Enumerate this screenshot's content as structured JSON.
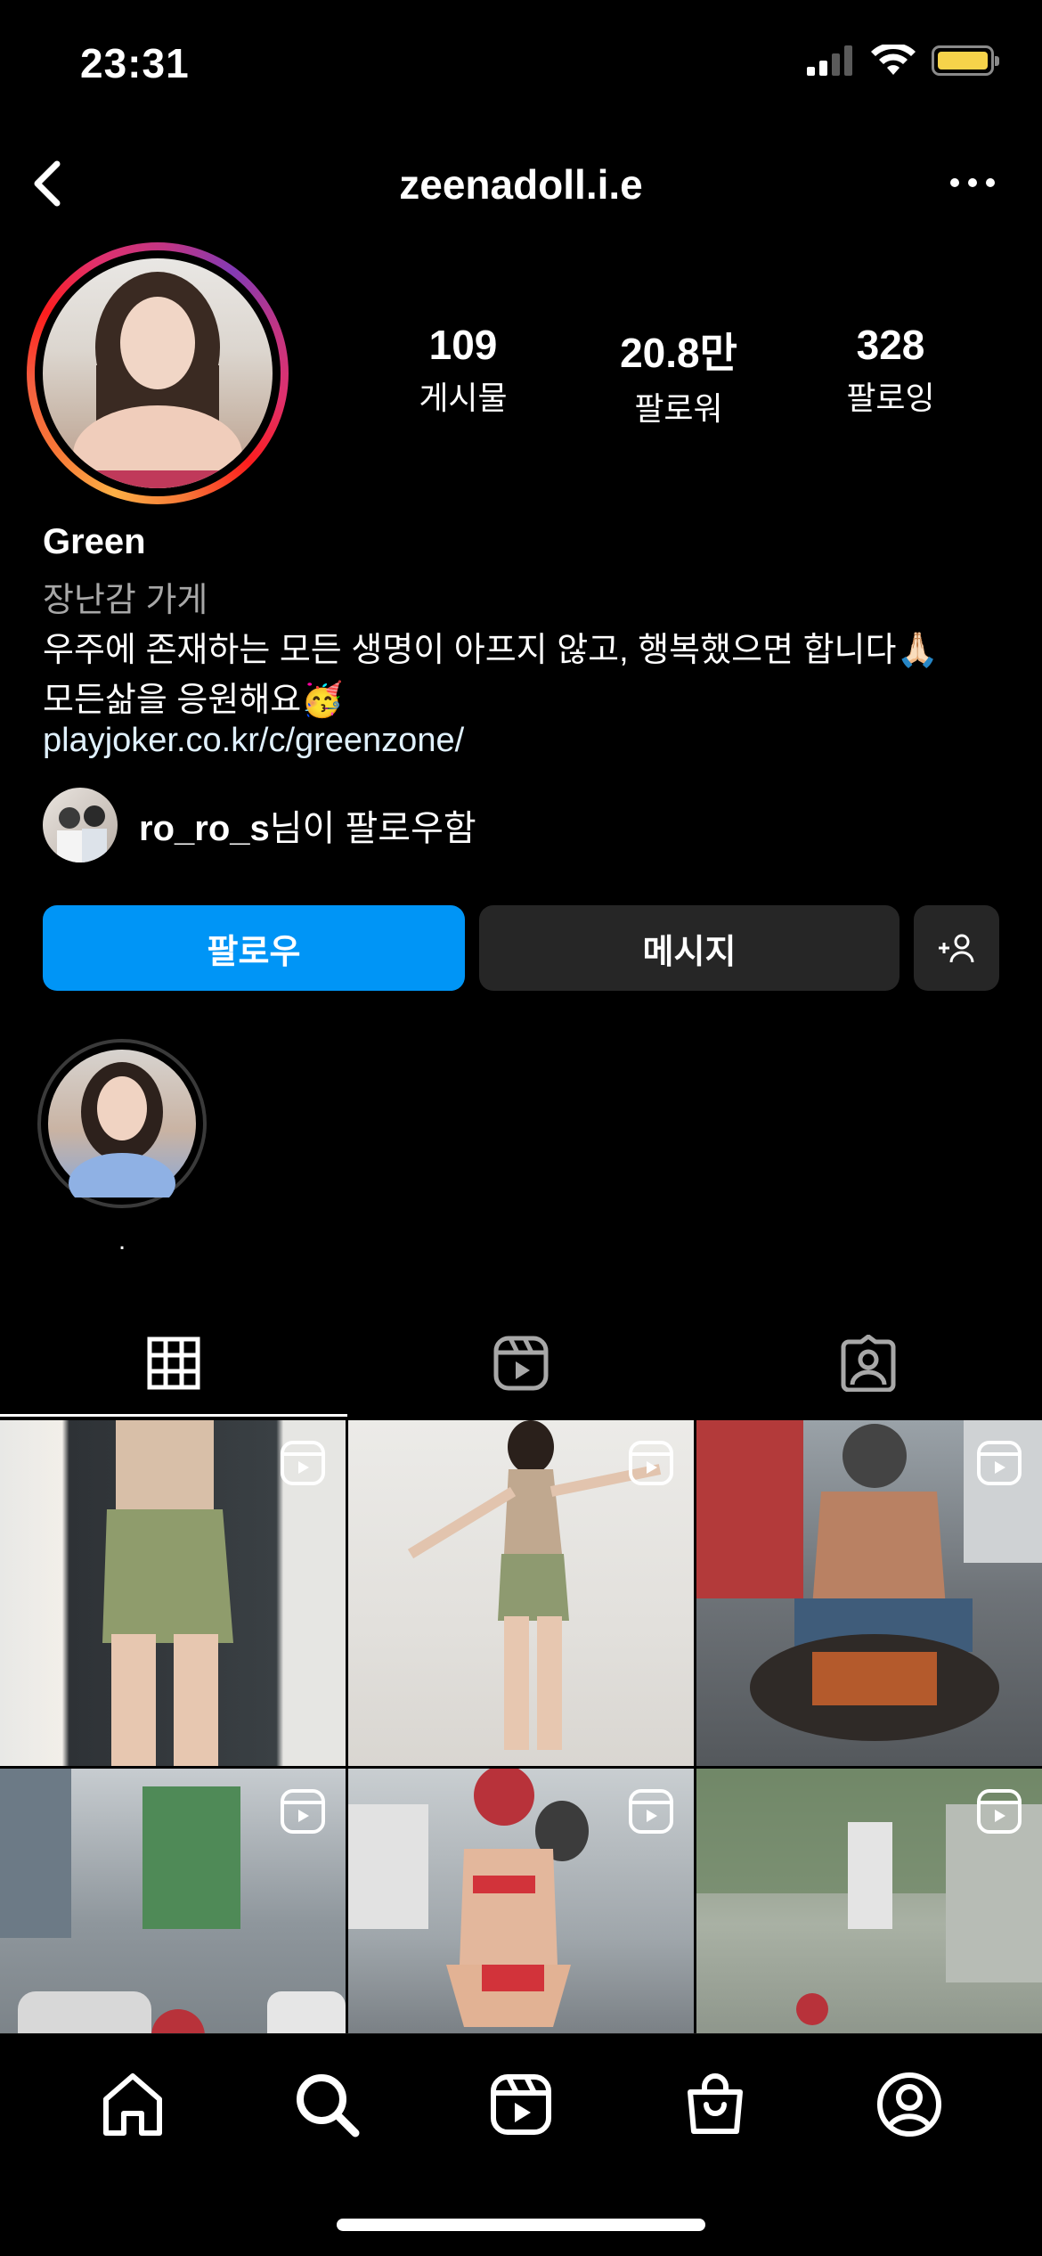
{
  "status": {
    "time": "23:31"
  },
  "header": {
    "username": "zeenadoll.i.e"
  },
  "stats": [
    {
      "value": "109",
      "label": "게시물"
    },
    {
      "value": "20.8만",
      "label": "팔로워"
    },
    {
      "value": "328",
      "label": "팔로잉"
    }
  ],
  "bio": {
    "name": "Green",
    "category": "장난감 가게",
    "line1": "우주에 존재하는 모든 생명이 아프지 않고, 행복했으면 합니다🙏🏻",
    "line2": "모든삶을 응원해요🥳",
    "link": "playjoker.co.kr/c/greenzone/"
  },
  "followed_by": {
    "user": "ro_ro_s",
    "suffix": "님이 팔로우함"
  },
  "buttons": {
    "follow": "팔로우",
    "message": "메시지",
    "suggest": "+👤"
  },
  "highlights": [
    {
      "label": "."
    }
  ],
  "tabs": [
    "grid",
    "reels",
    "tagged"
  ],
  "accent_color": "#0095f6",
  "grid_posts": [
    {
      "type": "reel",
      "palette": [
        "#d9d9d6",
        "#8e9a6c",
        "#f1ece6"
      ]
    },
    {
      "type": "reel",
      "palette": [
        "#e6e6e4",
        "#b5a38d",
        "#8f9a72"
      ]
    },
    {
      "type": "reel",
      "palette": [
        "#7a7a7a",
        "#9b6b4b",
        "#b43a3a"
      ]
    },
    {
      "type": "reel",
      "palette": [
        "#a9afb3",
        "#5f6468",
        "#c9c3bb"
      ]
    },
    {
      "type": "reel",
      "palette": [
        "#9aa0a5",
        "#d23b3b",
        "#4b4b4b"
      ]
    },
    {
      "type": "reel",
      "palette": [
        "#8e9a86",
        "#c8ccc4",
        "#6f7f6a"
      ]
    }
  ]
}
